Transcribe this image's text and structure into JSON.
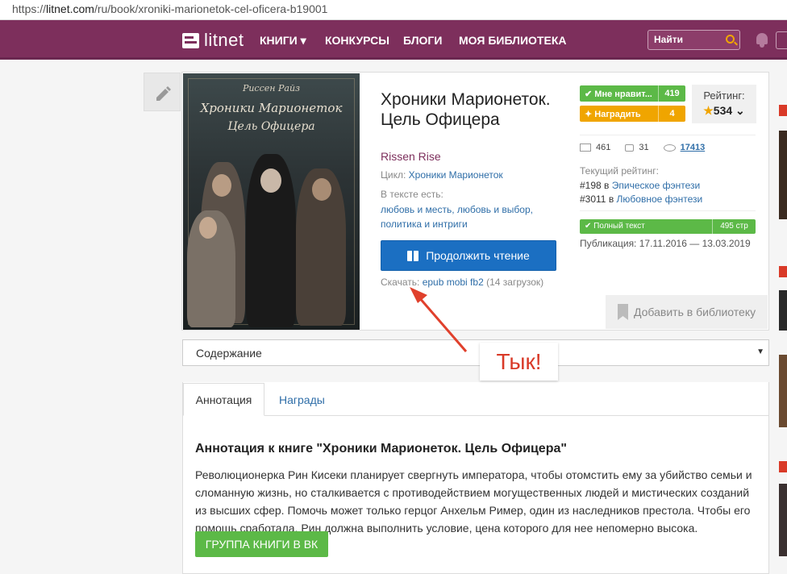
{
  "browser": {
    "url_prefix": "https://",
    "url_host": "litnet.com",
    "url_path": "/ru/book/xroniki-marionetok-cel-oficera-b19001"
  },
  "nav": {
    "logo": "litnet",
    "menu": [
      "КНИГИ ▾",
      "КОНКУРСЫ",
      "БЛОГИ",
      "МОЯ БИБЛИОТЕКА"
    ],
    "search_placeholder": "Найти"
  },
  "cover": {
    "author": "Риссен Райз",
    "title_line1": "Хроники Марионеток",
    "title_line2": "Цель Офицера"
  },
  "book": {
    "title": "Хроники Марионеток. Цель Офицера",
    "author": "Rissen Rise",
    "cycle_label": "Цикл:",
    "cycle": "Хроники Марионеток",
    "tags_label": "В тексте есть:",
    "tags": "любовь и месть, любовь и выбор, политика и интриги",
    "read_button": "Продолжить чтение",
    "download_label": "Скачать:",
    "formats": "epub mobi fb2",
    "downloads": "(14 загрузок)"
  },
  "badges": {
    "like_label": "Мне нравит...",
    "like_count": "419",
    "reward_label": "Наградить",
    "reward_count": "4"
  },
  "rating": {
    "label": "Рейтинг:",
    "value": "534",
    "star": "★",
    "chevron": "⌄"
  },
  "stats": {
    "pages": "461",
    "comments": "31",
    "views": "17413"
  },
  "current_rating": {
    "label": "Текущий рейтинг:",
    "rank1": "#198",
    "genre1": "Эпическое фэнтези",
    "rank2": "#3011",
    "genre2": "Любовное фэнтези",
    "in": "в"
  },
  "fulltext": {
    "label": "Полный текст",
    "pages": "495 стр"
  },
  "publication": "Публикация: 17.11.2016 — 13.03.2019",
  "add_library": "Добавить в библиотеку",
  "contents": {
    "label": "Содержание",
    "arrow": "▼"
  },
  "tooltip": "Тык!",
  "tabs": [
    "Аннотация",
    "Награды"
  ],
  "annotation": {
    "title": "Аннотация к книге \"Хроники Марионеток. Цель Офицера\"",
    "text": "Революционерка Рин Кисеки планирует свергнуть императора, чтобы отомстить ему за убийство семьи и сломанную жизнь, но сталкивается с противодействием могущественных людей и мистических созданий из высших сфер. Помочь может только герцог Анхельм Ример, один из наследников престола. Чтобы его помощь сработала, Рин должна выполнить условие, цена которого для нее непомерно высока.",
    "vk_button": "ГРУППА КНИГИ В ВК"
  },
  "colors": {
    "brand": "#7d2f5c",
    "green": "#5cb947",
    "orange": "#f0a500",
    "blue": "#1b6fc2",
    "link": "#2f6ea8",
    "annotation_red": "#d93a28"
  }
}
